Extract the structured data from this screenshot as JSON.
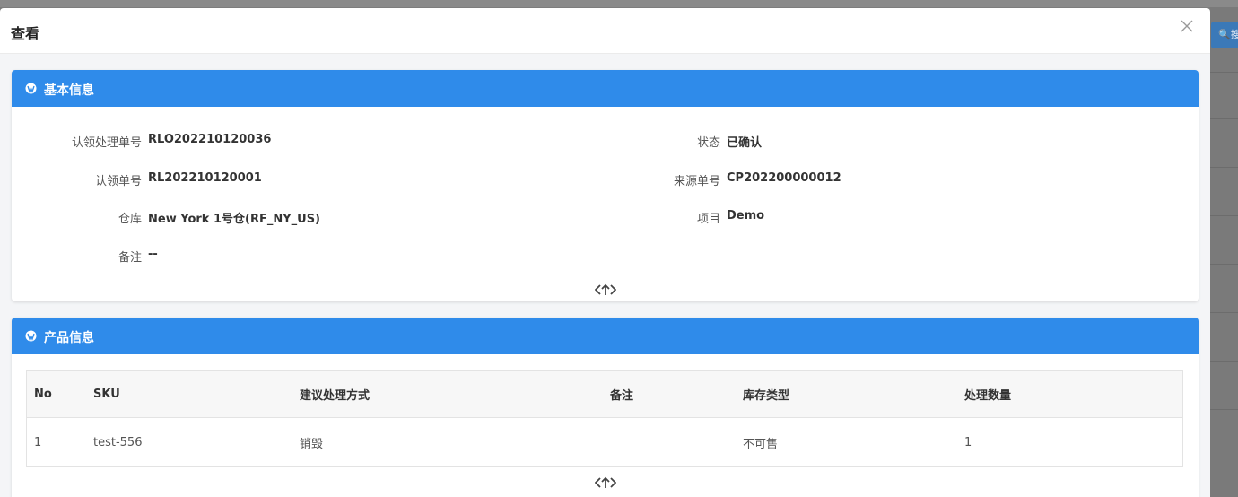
{
  "modal": {
    "title": "查看"
  },
  "background": {
    "search_label": "搜"
  },
  "basic_info": {
    "title": "基本信息",
    "fields": [
      {
        "label": "认领处理单号",
        "value": "RLO202210120036"
      },
      {
        "label": "状态",
        "value": "已确认"
      },
      {
        "label": "认领单号",
        "value": "RL202210120001"
      },
      {
        "label": "来源单号",
        "value": "CP202200000012"
      },
      {
        "label": "仓库",
        "value": "New York 1号仓(RF_NY_US)"
      },
      {
        "label": "项目",
        "value": "Demo"
      },
      {
        "label": "备注",
        "value": "--"
      }
    ]
  },
  "product_info": {
    "title": "产品信息",
    "columns": [
      "No",
      "SKU",
      "建议处理方式",
      "备注",
      "库存类型",
      "处理数量"
    ],
    "rows": [
      {
        "no": "1",
        "sku": "test-556",
        "method": "销毁",
        "remark": "",
        "stock_type": "不可售",
        "qty": "1"
      }
    ]
  },
  "colors": {
    "header_blue": "#2f8bea",
    "overlay": "#7d7d7d"
  }
}
